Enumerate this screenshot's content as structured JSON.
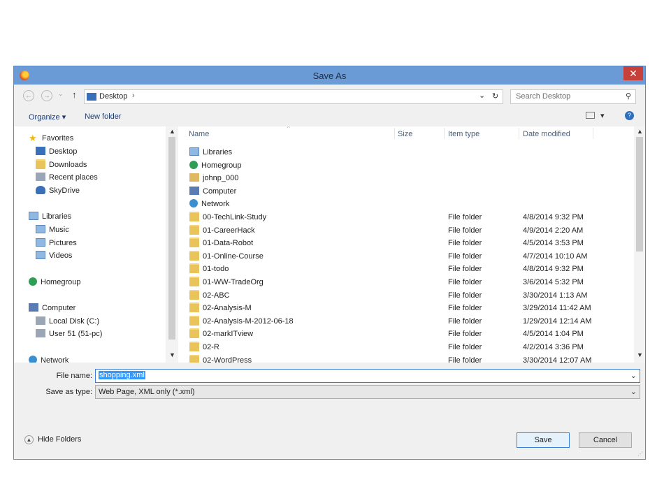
{
  "window": {
    "title": "Save As",
    "close_label": "✕"
  },
  "nav": {
    "back_glyph": "←",
    "forward_glyph": "→",
    "recent_glyph": "⌄",
    "up_glyph": "↑",
    "breadcrumb": "Desktop",
    "breadcrumb_arrow": "›",
    "dropdown_glyph": "⌄",
    "refresh_glyph": "↻",
    "search_placeholder": "Search Desktop"
  },
  "toolbar": {
    "organize": "Organize ▾",
    "new_folder": "New folder",
    "view_glyph": "▾",
    "help_glyph": "?"
  },
  "sidebar": {
    "items": [
      {
        "label": "Favorites",
        "icon": "star-icon",
        "level": 0
      },
      {
        "label": "Desktop",
        "icon": "desktop-icon",
        "level": 1
      },
      {
        "label": "Downloads",
        "icon": "downloads-icon",
        "level": 1
      },
      {
        "label": "Recent places",
        "icon": "recent-places-icon",
        "level": 1
      },
      {
        "label": "SkyDrive",
        "icon": "skydrive-icon",
        "level": 1
      },
      {
        "label": "Libraries",
        "icon": "libraries-icon",
        "level": 0
      },
      {
        "label": "Music",
        "icon": "music-icon",
        "level": 1
      },
      {
        "label": "Pictures",
        "icon": "pictures-icon",
        "level": 1
      },
      {
        "label": "Videos",
        "icon": "videos-icon",
        "level": 1
      },
      {
        "label": "Homegroup",
        "icon": "homegroup-icon",
        "level": 0
      },
      {
        "label": "Computer",
        "icon": "computer-icon",
        "level": 0
      },
      {
        "label": "Local Disk (C:)",
        "icon": "local-disk-icon",
        "level": 1
      },
      {
        "label": "User 51 (51-pc)",
        "icon": "network-drive-icon",
        "level": 1
      },
      {
        "label": "Network",
        "icon": "network-icon",
        "level": 0
      }
    ]
  },
  "columns": {
    "name": "Name",
    "size": "Size",
    "type": "Item type",
    "date": "Date modified"
  },
  "files": [
    {
      "name": "Libraries",
      "type": "",
      "date": "",
      "icon": "libraries-icon"
    },
    {
      "name": "Homegroup",
      "type": "",
      "date": "",
      "icon": "homegroup-icon"
    },
    {
      "name": "johnp_000",
      "type": "",
      "date": "",
      "icon": "user-folder-icon"
    },
    {
      "name": "Computer",
      "type": "",
      "date": "",
      "icon": "computer-icon"
    },
    {
      "name": "Network",
      "type": "",
      "date": "",
      "icon": "network-icon"
    },
    {
      "name": "00-TechLink-Study",
      "type": "File folder",
      "date": "4/8/2014 9:32 PM",
      "icon": "folder-icon"
    },
    {
      "name": "01-CareerHack",
      "type": "File folder",
      "date": "4/9/2014 2:20 AM",
      "icon": "folder-icon"
    },
    {
      "name": "01-Data-Robot",
      "type": "File folder",
      "date": "4/5/2014 3:53 PM",
      "icon": "folder-icon"
    },
    {
      "name": "01-Online-Course",
      "type": "File folder",
      "date": "4/7/2014 10:10 AM",
      "icon": "folder-icon"
    },
    {
      "name": "01-todo",
      "type": "File folder",
      "date": "4/8/2014 9:32 PM",
      "icon": "folder-icon"
    },
    {
      "name": "01-WW-TradeOrg",
      "type": "File folder",
      "date": "3/6/2014 5:32 PM",
      "icon": "folder-icon"
    },
    {
      "name": "02-ABC",
      "type": "File folder",
      "date": "3/30/2014 1:13 AM",
      "icon": "folder-icon"
    },
    {
      "name": "02-Analysis-M",
      "type": "File folder",
      "date": "3/29/2014 11:42 AM",
      "icon": "folder-icon"
    },
    {
      "name": "02-Analysis-M-2012-06-18",
      "type": "File folder",
      "date": "1/29/2014 12:14 AM",
      "icon": "folder-icon"
    },
    {
      "name": "02-markITview",
      "type": "File folder",
      "date": "4/5/2014 1:04 PM",
      "icon": "folder-icon"
    },
    {
      "name": "02-R",
      "type": "File folder",
      "date": "4/2/2014 3:36 PM",
      "icon": "folder-icon"
    },
    {
      "name": "02-WordPress",
      "type": "File folder",
      "date": "3/30/2014 12:07 AM",
      "icon": "folder-icon"
    }
  ],
  "form": {
    "filename_label": "File name:",
    "filename_value": "shopping.xml",
    "savetype_label": "Save as type:",
    "savetype_value": "Web Page, XML only (*.xml)"
  },
  "footer": {
    "hide_folders": "Hide Folders",
    "save": "Save",
    "cancel": "Cancel"
  }
}
